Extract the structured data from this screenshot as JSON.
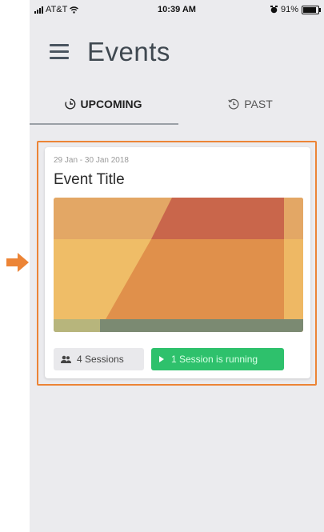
{
  "status_bar": {
    "carrier": "AT&T",
    "time": "10:39 AM",
    "battery": "91%"
  },
  "header": {
    "title": "Events"
  },
  "tabs": [
    {
      "label": "UPCOMING",
      "active": true,
      "icon": "clock-icon"
    },
    {
      "label": "PAST",
      "active": false,
      "icon": "history-icon"
    }
  ],
  "events": [
    {
      "date_range": "29 Jan - 30 Jan 2018",
      "title": "Event Title",
      "sessions_label": "4 Sessions",
      "running_label": "1 Session is running"
    }
  ],
  "colors": {
    "accent_outline": "#ec8436",
    "running_green": "#2ec16c",
    "header_text": "#3f4850",
    "background": "#ebebee"
  }
}
